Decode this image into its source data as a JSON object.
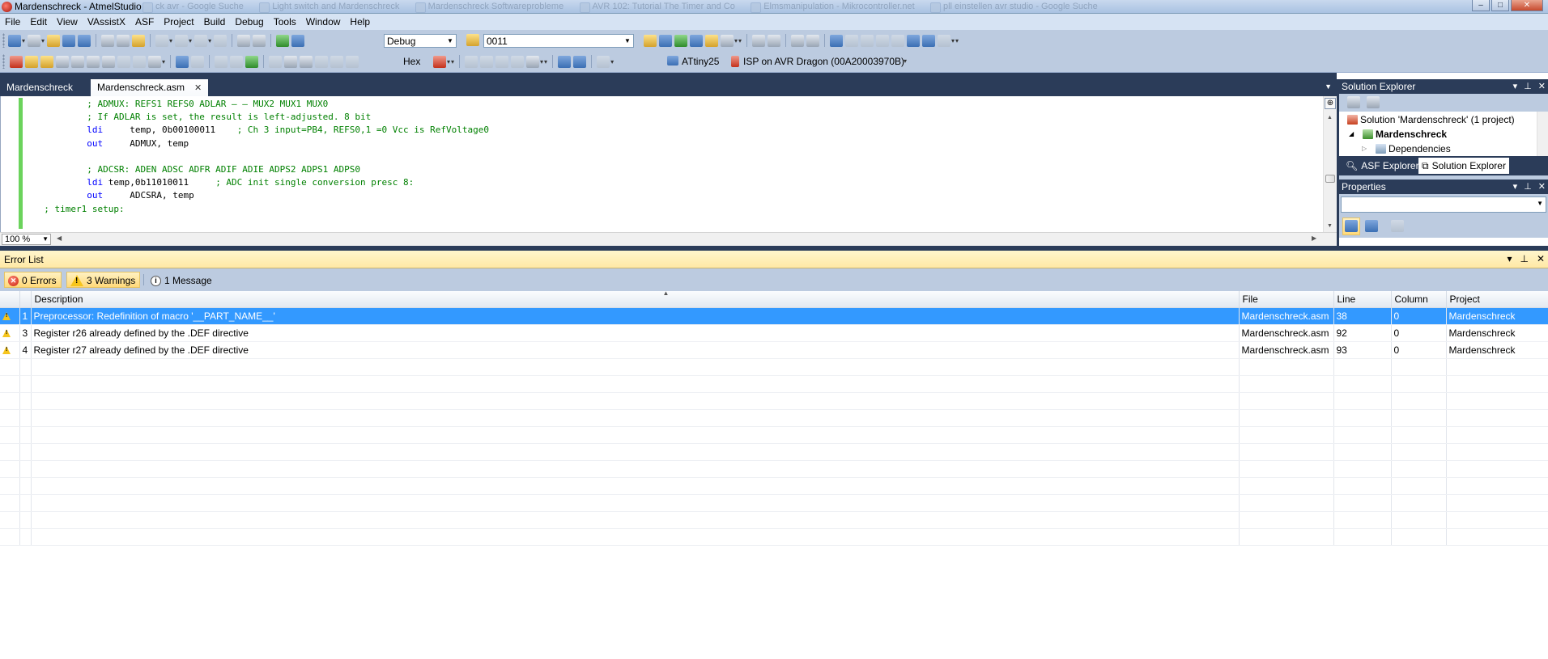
{
  "window": {
    "title": "Mardenschreck - AtmelStudio",
    "background_tabs": [
      "Light switch and Mardenschreck",
      "Mardenschreck Softwareprobleme",
      "AVR 102: Tutorial The Timer and Co",
      "Elmsmanipulation - Mikrocontroller.net",
      "pll einstellen avr studio - Google Suche"
    ],
    "background_tab_prefix": "ck avr - Google Suche",
    "controls": {
      "minimize": "–",
      "maximize": "□",
      "close": "✕"
    }
  },
  "menu": [
    "File",
    "Edit",
    "View",
    "VAssistX",
    "ASF",
    "Project",
    "Build",
    "Debug",
    "Tools",
    "Window",
    "Help"
  ],
  "toolbar": {
    "configuration": "Debug",
    "find_value": "0011",
    "hex_label": "Hex",
    "device": "ATtiny25",
    "tool": "ISP on AVR Dragon (00A20003970B)"
  },
  "document_tabs": [
    {
      "label": "Mardenschreck",
      "active": false
    },
    {
      "label": "Mardenschreck.asm",
      "active": true
    }
  ],
  "editor": {
    "zoom": "100 %",
    "lines": [
      {
        "kind": "comment",
        "indent": "          ",
        "text": "; ADMUX: REFS1 REFS0 ADLAR – – MUX2 MUX1 MUX0"
      },
      {
        "kind": "comment",
        "indent": "          ",
        "text": "; If ADLAR is set, the result is left-adjusted. 8 bit"
      },
      {
        "kind": "instr",
        "indent": "          ",
        "mnemonic": "ldi",
        "operands": "     temp, 0b00100011    ",
        "comment": "; Ch 3 input=PB4, REFS0,1 =0 Vcc is RefVoltage0"
      },
      {
        "kind": "instr",
        "indent": "          ",
        "mnemonic": "out",
        "operands": "     ADMUX, temp",
        "comment": ""
      },
      {
        "kind": "blank",
        "indent": "",
        "text": ""
      },
      {
        "kind": "comment",
        "indent": "          ",
        "text": "; ADCSR: ADEN ADSC ADFR ADIF ADIE ADPS2 ADPS1 ADPS0"
      },
      {
        "kind": "instr",
        "indent": "          ",
        "mnemonic": "ldi",
        "operands": " temp,0b11010011     ",
        "comment": "; ADC init single conversion presc 8:"
      },
      {
        "kind": "instr",
        "indent": "          ",
        "mnemonic": "out",
        "operands": "     ADCSRA, temp",
        "comment": ""
      },
      {
        "kind": "comment",
        "indent": "  ",
        "text": "; timer1 setup:"
      }
    ]
  },
  "error_list": {
    "title": "Error List",
    "filters": {
      "errors": "0 Errors",
      "warnings": "3 Warnings",
      "messages": "1 Message"
    },
    "columns": {
      "description": "Description",
      "file": "File",
      "line": "Line",
      "column": "Column",
      "project": "Project"
    },
    "rows": [
      {
        "num": "1",
        "description": "Preprocessor: Redefinition of macro '__PART_NAME__'",
        "file": "Mardenschreck.asm",
        "line": "38",
        "column": "0",
        "project": "Mardenschreck",
        "selected": true
      },
      {
        "num": "3",
        "description": "Register r26 already defined by the .DEF directive",
        "file": "Mardenschreck.asm",
        "line": "92",
        "column": "0",
        "project": "Mardenschreck",
        "selected": false
      },
      {
        "num": "4",
        "description": "Register r27 already defined by the .DEF directive",
        "file": "Mardenschreck.asm",
        "line": "93",
        "column": "0",
        "project": "Mardenschreck",
        "selected": false
      }
    ],
    "empty_rows": 11
  },
  "solution_explorer": {
    "title": "Solution Explorer",
    "tree": [
      {
        "label": "Solution 'Mardenschreck' (1 project)",
        "bold": false
      },
      {
        "label": "Mardenschreck",
        "bold": true
      },
      {
        "label": "Dependencies",
        "bold": false
      }
    ],
    "tabs": [
      {
        "label": "ASF Explorer",
        "active": false
      },
      {
        "label": "Solution Explorer",
        "active": true
      }
    ]
  },
  "properties": {
    "title": "Properties"
  },
  "colors": {
    "dark_frame": "#2b3c59",
    "toolbar": "#bccbe0",
    "selection": "#3399ff",
    "comment": "#008000",
    "keyword": "#0000ff",
    "changebar": "#6bd35c"
  }
}
